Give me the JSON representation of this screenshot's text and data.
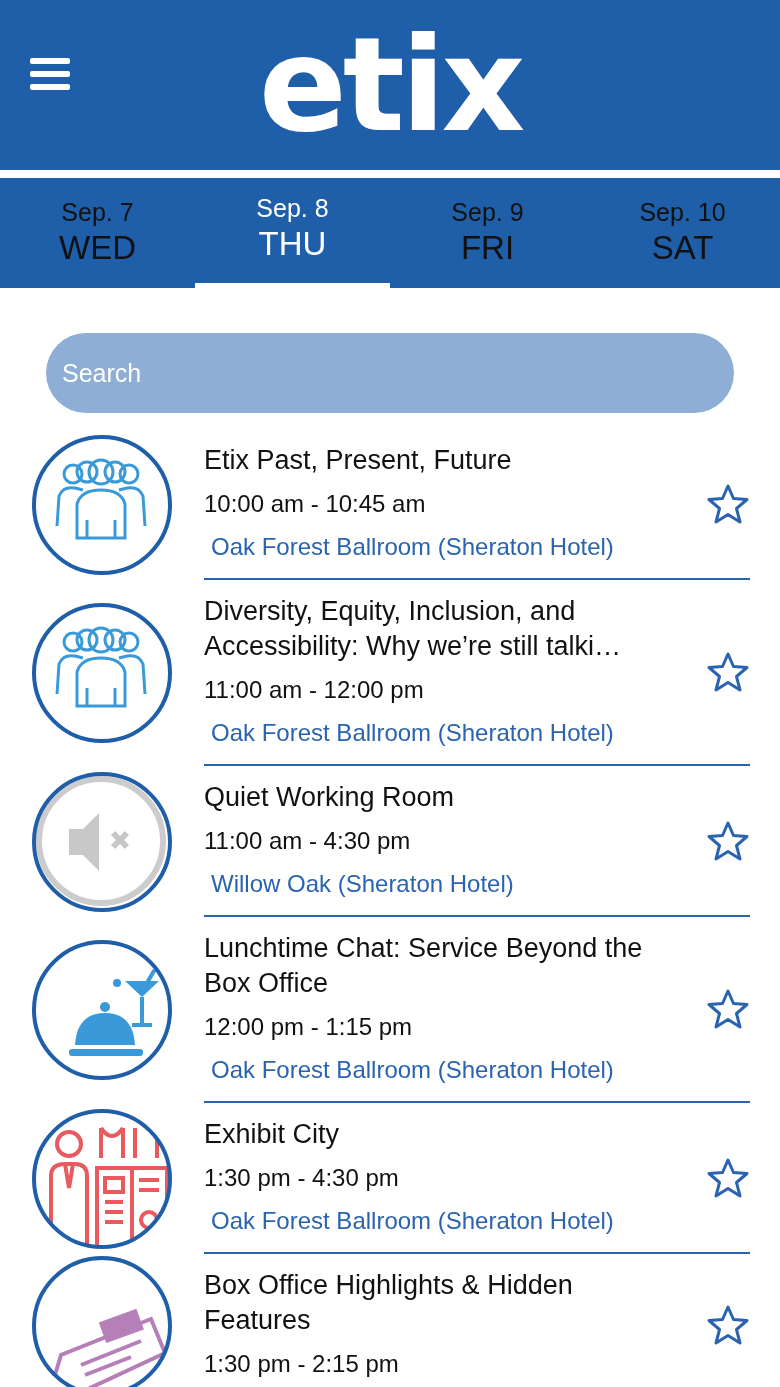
{
  "header": {
    "logo": "etix"
  },
  "tabs": [
    {
      "date": "Sep. 7",
      "day": "WED",
      "selected": false
    },
    {
      "date": "Sep. 8",
      "day": "THU",
      "selected": true
    },
    {
      "date": "Sep. 9",
      "day": "FRI",
      "selected": false
    },
    {
      "date": "Sep. 10",
      "day": "SAT",
      "selected": false
    }
  ],
  "search": {
    "placeholder": "Search"
  },
  "sessions": [
    {
      "kind": "group",
      "title": "Etix Past, Present, Future",
      "time": "10:00 am - 10:45 am",
      "location": "Oak Forest Ballroom (Sheraton Hotel)",
      "favorite": false
    },
    {
      "kind": "group",
      "title": "Diversity, Equity, Inclusion, and Accessibility: Why we’re still talki…",
      "time": "11:00 am - 12:00 pm",
      "location": "Oak Forest Ballroom (Sheraton Hotel)",
      "favorite": false
    },
    {
      "kind": "muted",
      "title": "Quiet Working Room",
      "time": "11:00 am - 4:30 pm",
      "location": "Willow Oak (Sheraton Hotel)",
      "favorite": false
    },
    {
      "kind": "dining",
      "title": "Lunchtime Chat: Service Beyond the Box Office",
      "time": "12:00 pm - 1:15 pm",
      "location": "Oak Forest Ballroom (Sheraton Hotel)",
      "favorite": false
    },
    {
      "kind": "exhibit",
      "title": "Exhibit City",
      "time": "1:30 pm - 4:30 pm",
      "location": "Oak Forest Ballroom (Sheraton Hotel)",
      "favorite": false
    },
    {
      "kind": "ticket",
      "title": "Box Office Highlights & Hidden Features",
      "time": "1:30 pm - 2:15 pm",
      "favorite": false
    }
  ]
}
